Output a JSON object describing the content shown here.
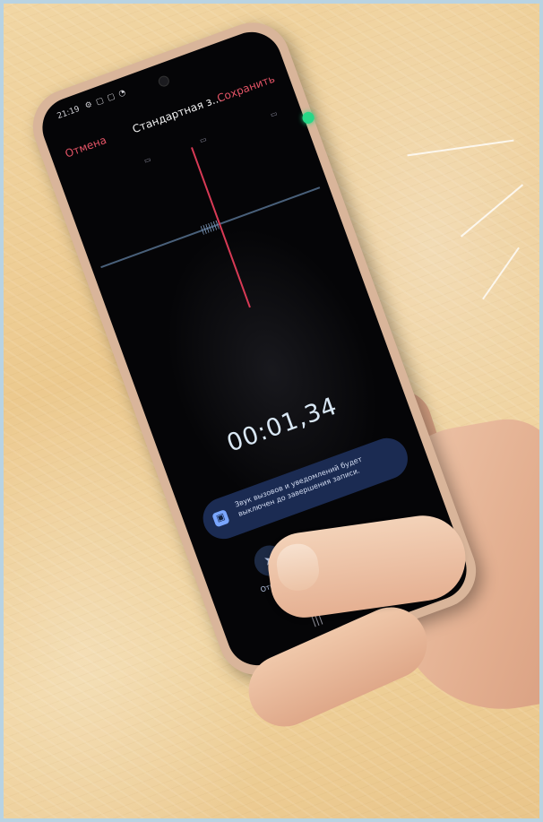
{
  "recorder_app": {
    "status_time": "21:19",
    "cancel_label": "Отмена",
    "title": "Стандартная з...",
    "save_label": "Сохранить",
    "elapsed_time": "00:01,34",
    "toast_text": "Звук вызовов и уведомлений будет выключен до завершения записи.",
    "mark_button_label": "Отметить"
  },
  "colors": {
    "accent_red": "#e45466",
    "led_green": "#27d887",
    "toast_bg": "#1b2b52"
  },
  "icons": {
    "mark": "bookmark-arrow-icon",
    "toast": "notification-icon",
    "nav_recents": "recents-icon",
    "nav_home": "home-icon"
  }
}
